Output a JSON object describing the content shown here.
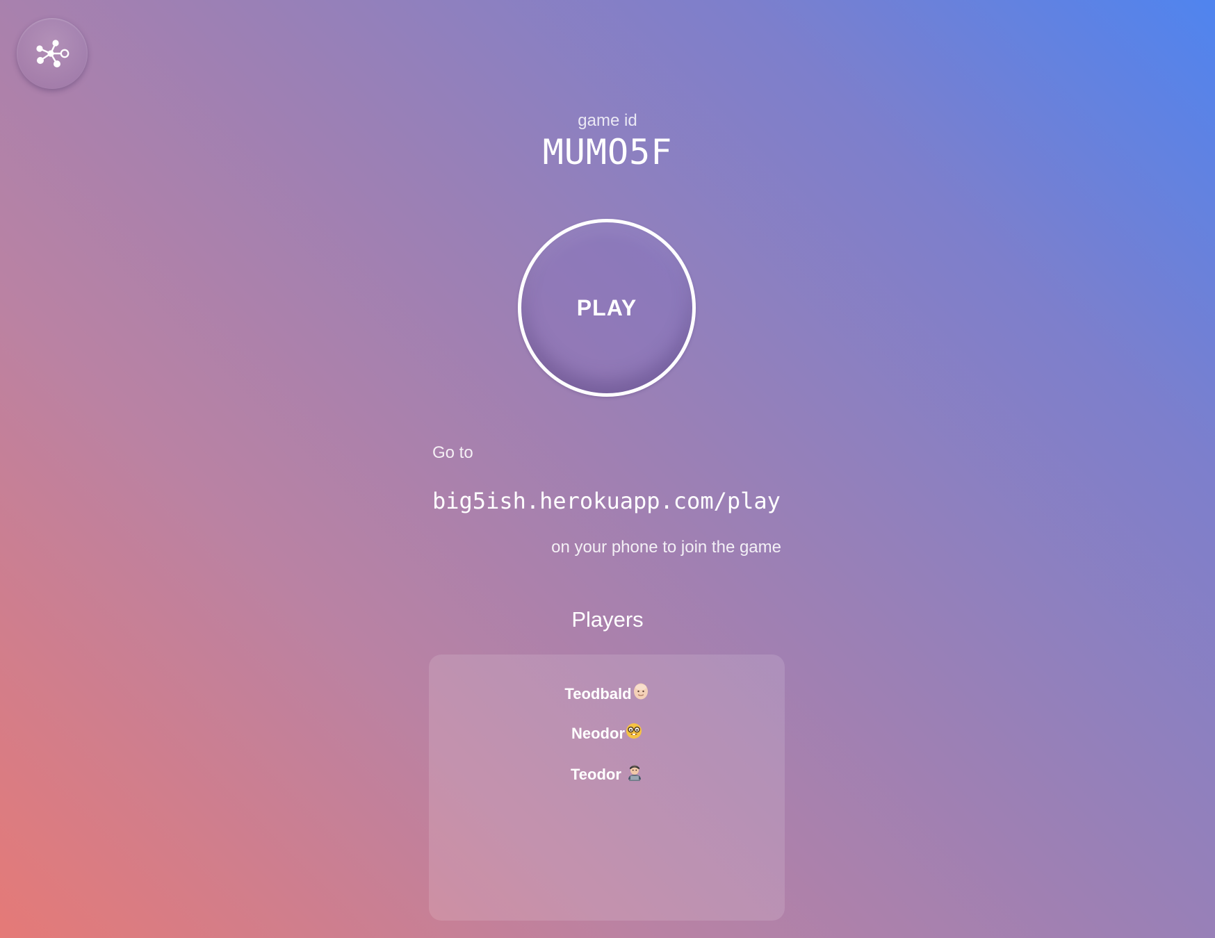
{
  "header": {
    "game_id_label": "game id",
    "game_id": "MUMO5F"
  },
  "play_button": {
    "label": "PLAY"
  },
  "instructions": {
    "goto_label": "Go to",
    "url": "big5ish.herokuapp.com/play",
    "join_text": "on your phone to join the game"
  },
  "players": {
    "title": "Players",
    "list": [
      {
        "name": "Teodbald",
        "avatar": "bald-face-emoji"
      },
      {
        "name": "Neodor",
        "avatar": "nerd-face-emoji"
      },
      {
        "name": "Teodor",
        "avatar": "technologist-emoji"
      }
    ]
  },
  "icons": {
    "share": "share-network-icon"
  },
  "colors": {
    "gradient_bottom_left": "#e57a77",
    "gradient_top_right": "#4f84ef",
    "text": "#ffffff"
  }
}
